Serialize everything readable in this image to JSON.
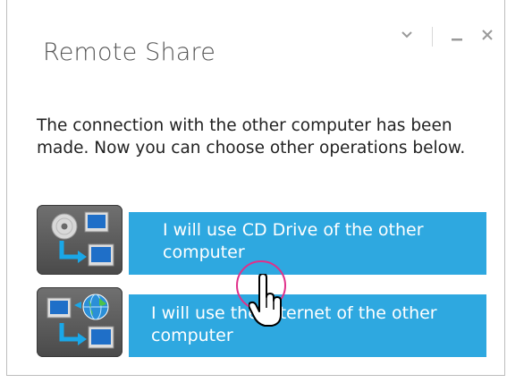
{
  "window": {
    "title": "Remote Share",
    "controls": {
      "collapse_icon": "chevron-down-icon",
      "minimize_icon": "minimize-icon",
      "close_icon": "close-icon"
    }
  },
  "message": "The connection with the other computer has been made. Now you can choose other operations below.",
  "options": [
    {
      "label": "I will use CD Drive of the other computer",
      "icon": "cd-drive-share-icon"
    },
    {
      "label": "I will use the Internet of the other computer",
      "icon": "internet-share-icon"
    }
  ],
  "colors": {
    "button_blue": "#2ea8e0",
    "icon_tile": "#5a5a5a",
    "cursor_ring": "#e0308a"
  },
  "cursor": "hand-pointer-icon"
}
